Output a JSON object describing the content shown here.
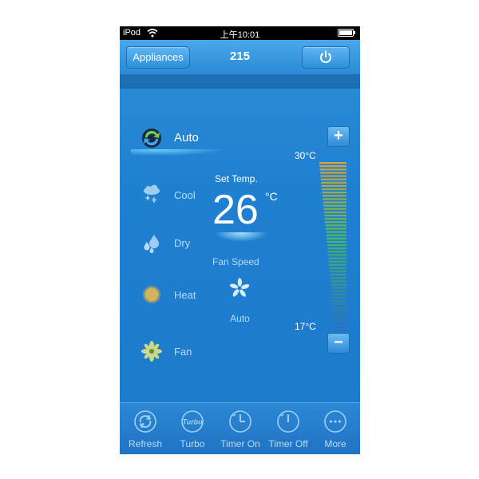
{
  "status_bar": {
    "carrier": "iPod",
    "time": "上午10:01"
  },
  "nav": {
    "back_label": "Appliances",
    "title": "215"
  },
  "modes": [
    {
      "label": "Auto",
      "icon": "auto-mode-icon",
      "selected": true
    },
    {
      "label": "Cool",
      "icon": "snowflake-cloud-icon",
      "selected": false
    },
    {
      "label": "Dry",
      "icon": "droplets-icon",
      "selected": false
    },
    {
      "label": "Heat",
      "icon": "sun-icon",
      "selected": false
    },
    {
      "label": "Fan",
      "icon": "fan-icon",
      "selected": false
    }
  ],
  "temperature": {
    "set_label": "Set Temp.",
    "value": "26",
    "unit": "°C",
    "max_label": "30°C",
    "min_label": "17°C",
    "plus": "+",
    "minus": "−"
  },
  "fan": {
    "label": "Fan Speed",
    "value": "Auto"
  },
  "toolbar": [
    {
      "label": "Refresh",
      "icon": "refresh-icon"
    },
    {
      "label": "Turbo",
      "icon": "turbo-icon",
      "icon_text": "Turbo"
    },
    {
      "label": "Timer On",
      "icon": "timer-on-icon"
    },
    {
      "label": "Timer Off",
      "icon": "timer-off-icon"
    },
    {
      "label": "More",
      "icon": "more-icon"
    }
  ],
  "colors": {
    "background": "#1f7fd0",
    "accent": "#2b8ad6",
    "label": "#b9dcf6",
    "scale_hot": "#d9a23a",
    "scale_mid": "#48b95f",
    "scale_cold": "#2a6fc0"
  }
}
